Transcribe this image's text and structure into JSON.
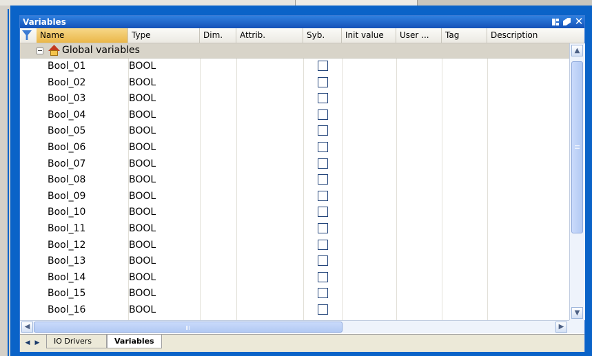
{
  "window": {
    "title": "Variables"
  },
  "columns": [
    "Name",
    "Type",
    "Dim.",
    "Attrib.",
    "Syb.",
    "Init value",
    "User ...",
    "Tag",
    "Description"
  ],
  "group": {
    "label": "Global variables"
  },
  "rows": [
    {
      "name": "Bool_01",
      "type": "BOOL"
    },
    {
      "name": "Bool_02",
      "type": "BOOL"
    },
    {
      "name": "Bool_03",
      "type": "BOOL"
    },
    {
      "name": "Bool_04",
      "type": "BOOL"
    },
    {
      "name": "Bool_05",
      "type": "BOOL"
    },
    {
      "name": "Bool_06",
      "type": "BOOL"
    },
    {
      "name": "Bool_07",
      "type": "BOOL"
    },
    {
      "name": "Bool_08",
      "type": "BOOL"
    },
    {
      "name": "Bool_09",
      "type": "BOOL"
    },
    {
      "name": "Bool_10",
      "type": "BOOL"
    },
    {
      "name": "Bool_11",
      "type": "BOOL"
    },
    {
      "name": "Bool_12",
      "type": "BOOL"
    },
    {
      "name": "Bool_13",
      "type": "BOOL"
    },
    {
      "name": "Bool_14",
      "type": "BOOL"
    },
    {
      "name": "Bool_15",
      "type": "BOOL"
    },
    {
      "name": "Bool_16",
      "type": "BOOL"
    }
  ],
  "tabs": [
    {
      "label": "IO Drivers",
      "active": false
    },
    {
      "label": "Variables",
      "active": true
    }
  ],
  "icons": {
    "filter": "filter-icon",
    "dock": "dock-icon",
    "pin": "pin-icon",
    "close": "close-icon",
    "group": "home-icon"
  },
  "colors": {
    "frame": "#0a63c8",
    "titlebar": "#1552b8",
    "name_header": "#eab749",
    "group_row": "#d8d4c9"
  }
}
